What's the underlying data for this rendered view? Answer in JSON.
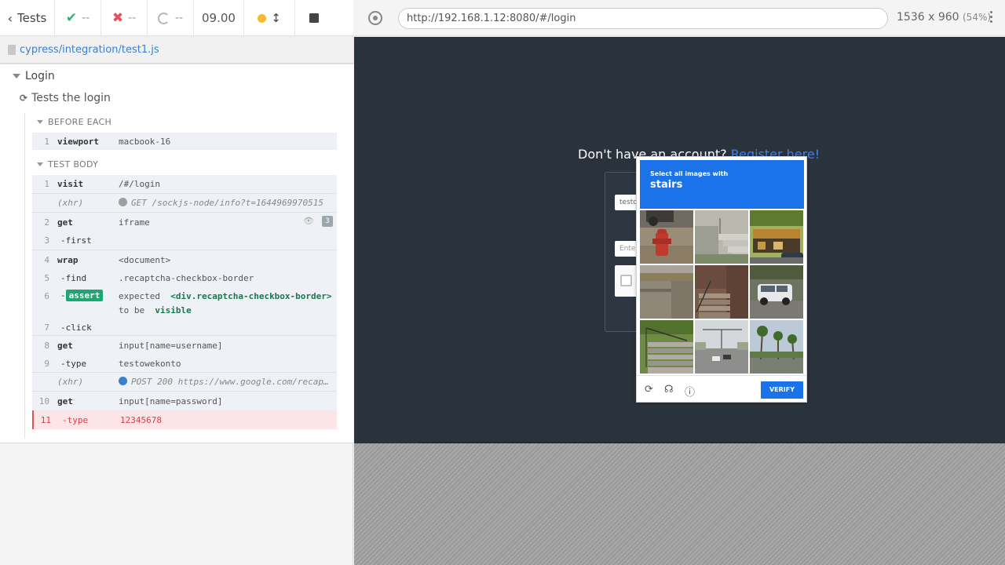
{
  "reporter": {
    "tests_label": "Tests",
    "passed": "--",
    "failed": "--",
    "pending": "--",
    "duration": "09.00",
    "file_path": "cypress/integration/test1.js",
    "suite_title": "Login",
    "test_title": "Tests the login",
    "before_each_label": "BEFORE EACH",
    "test_body_label": "TEST BODY",
    "before_each": [
      {
        "num": "1",
        "name": "viewport",
        "message": "macbook-16"
      }
    ],
    "commands": [
      {
        "num": "1",
        "name": "visit",
        "message": "/#/login"
      },
      {
        "num": "",
        "name": "(xhr)",
        "message": "GET /sockjs-node/info?t=1644969970515"
      },
      {
        "num": "2",
        "name": "get",
        "message": "iframe",
        "count": "3"
      },
      {
        "num": "3",
        "name": "-first",
        "message": ""
      },
      {
        "num": "4",
        "name": "wrap",
        "message": "<document>"
      },
      {
        "num": "5",
        "name": "-find",
        "message": ".recaptcha-checkbox-border"
      },
      {
        "num": "6",
        "name": "-",
        "badge": "assert",
        "message_pre": "expected",
        "message_el": "<div.recaptcha-checkbox-border>",
        "message_mid": "to be",
        "message_end": "visible"
      },
      {
        "num": "7",
        "name": "-click",
        "message": ""
      },
      {
        "num": "8",
        "name": "get",
        "message": "input[name=username]"
      },
      {
        "num": "9",
        "name": "-type",
        "message": "testowekonto"
      },
      {
        "num": "",
        "name": "(xhr)",
        "message": "POST 200 https://www.google.com/recap…"
      },
      {
        "num": "10",
        "name": "get",
        "message": "input[name=password]"
      },
      {
        "num": "11",
        "name": "-type",
        "message": "12345678"
      }
    ]
  },
  "aut": {
    "url": "http://192.168.1.12:8080/#/login",
    "viewport": "1536 x 960",
    "zoom": "(54%)",
    "register_text": "Don't have an account?",
    "register_link": "Register here!",
    "username_value": "testo",
    "password_placeholder": "Enter"
  },
  "captcha": {
    "line1": "Select all images with",
    "line2": "stairs",
    "verify_label": "VERIFY",
    "header_color": "#1a73e8",
    "tiles": [
      "fire hydrant",
      "stairs",
      "storefront",
      "road",
      "stairs",
      "suv",
      "stairs",
      "street",
      "palm trees"
    ]
  },
  "colors": {
    "pass": "#2bb673",
    "fail": "#e94f5b",
    "pending_running": "#f4bc2f",
    "link": "#3b7fd1",
    "aut_background": "#2a323c"
  }
}
